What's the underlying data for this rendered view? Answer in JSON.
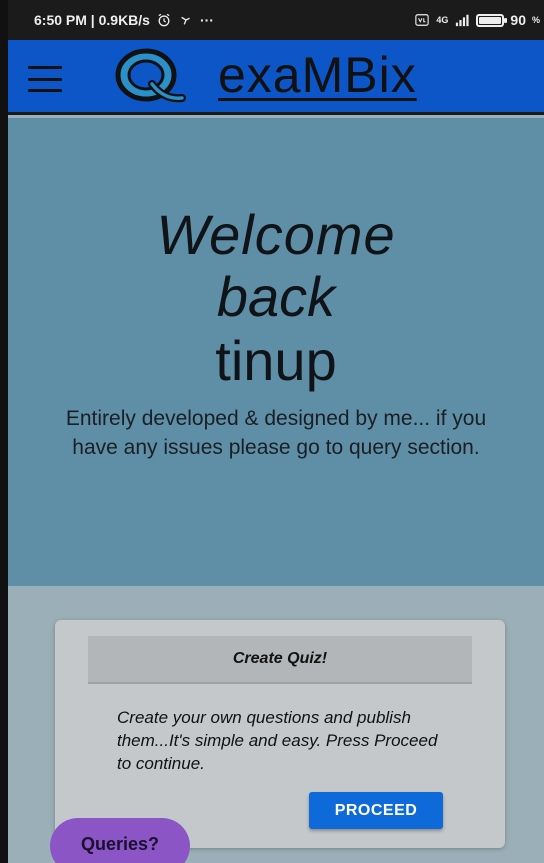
{
  "status_bar": {
    "time_speed": "6:50 PM | 0.9KB/s",
    "more": "···",
    "network": "4G",
    "battery_text": "90",
    "battery_unit": "%",
    "battery_level": 0.9
  },
  "app_bar": {
    "brand": "exaMBix",
    "logo_letter": "Q"
  },
  "hero": {
    "welcome": "Welcome",
    "back": "back",
    "username": "tinup",
    "description": "Entirely developed & designed by me... if you have any issues please go to query section."
  },
  "card": {
    "title": "Create Quiz!",
    "body": "Create your own questions and publish them...It's simple and easy. Press Proceed to continue.",
    "button": "PROCEED"
  },
  "floating": {
    "queries": "Queries?"
  },
  "colors": {
    "app_bar": "#0d56c8",
    "hero_bg": "#5f8fa6",
    "page_bg": "#9aafb7",
    "proceed": "#0d6ad8",
    "queries": "#8c55c6"
  }
}
